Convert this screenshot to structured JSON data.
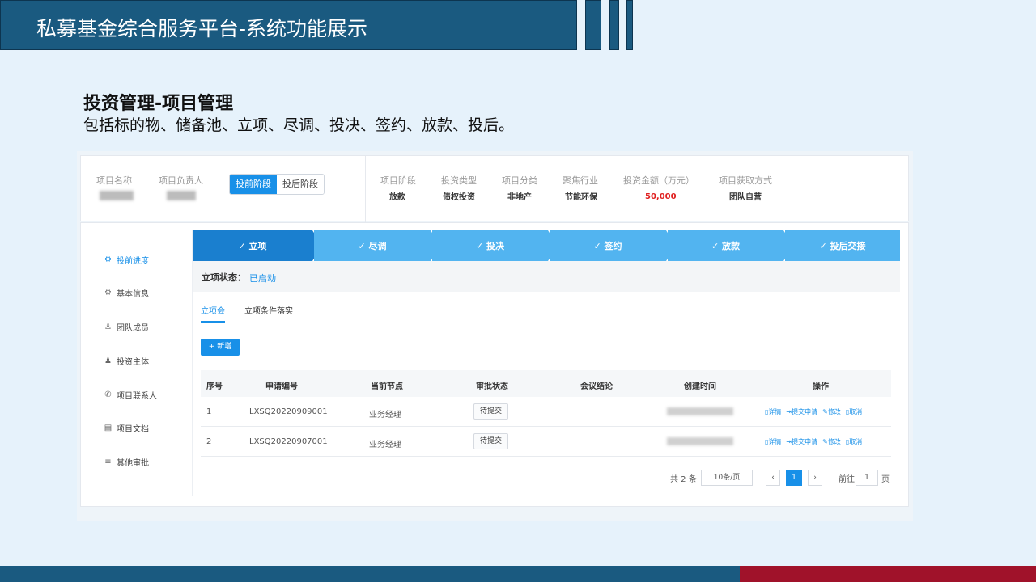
{
  "slide": {
    "title": "私募基金综合服务平台-系统功能展示",
    "heading": "投资管理-项目管理",
    "subheading": "包括标的物、储备池、立项、尽调、投决、签约、放款、投后。"
  },
  "project_header": {
    "name_label": "项目名称",
    "owner_label": "项目负责人",
    "stage_toggle": [
      "投前阶段",
      "投后阶段"
    ],
    "fields": [
      {
        "label": "项目阶段",
        "value": "放款"
      },
      {
        "label": "投资类型",
        "value": "债权投资"
      },
      {
        "label": "项目分类",
        "value": "非地产"
      },
      {
        "label": "聚焦行业",
        "value": "节能环保"
      },
      {
        "label": "投资金额（万元）",
        "value": "50,000"
      },
      {
        "label": "项目获取方式",
        "value": "团队自营"
      }
    ],
    "amount_color": "#e02020"
  },
  "sidebar": {
    "items": [
      {
        "label": "投前进度",
        "icon": "gear-icon"
      },
      {
        "label": "基本信息",
        "icon": "gear-icon"
      },
      {
        "label": "团队成员",
        "icon": "person-outline-icon"
      },
      {
        "label": "投资主体",
        "icon": "person-icon"
      },
      {
        "label": "项目联系人",
        "icon": "phone-icon"
      },
      {
        "label": "项目文档",
        "icon": "document-icon"
      },
      {
        "label": "其他审批",
        "icon": "list-icon"
      }
    ]
  },
  "steps": [
    "✓ 立项",
    "✓ 尽调",
    "✓ 投决",
    "✓ 签约",
    "✓ 放款",
    "✓ 投后交接"
  ],
  "status": {
    "label": "立项状态：",
    "value": "已启动"
  },
  "tabs": [
    "立项会",
    "立项条件落实"
  ],
  "new_button": "+ 新增",
  "table": {
    "columns": [
      "序号",
      "申请编号",
      "当前节点",
      "审批状态",
      "会议结论",
      "创建时间",
      "操作"
    ],
    "rows": [
      {
        "no": "1",
        "code": "LXSQ20220909001",
        "node": "业务经理",
        "status": "待提交"
      },
      {
        "no": "2",
        "code": "LXSQ20220907001",
        "node": "业务经理",
        "status": "待提交"
      }
    ],
    "actions": [
      "详情",
      "提交申请",
      "修改",
      "取消"
    ]
  },
  "pagination": {
    "total": "共 2 条",
    "page_size": "10条/页",
    "prev": "‹",
    "current": "1",
    "next": "›",
    "goto_label": "前往",
    "goto_value": "1",
    "page_suffix": "页"
  },
  "colors": {
    "brand_blue": "#1a5a80",
    "accent_red": "#a0122a",
    "primary": "#1890e8"
  }
}
